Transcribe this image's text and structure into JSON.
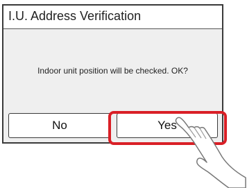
{
  "dialog": {
    "title": "I.U. Address Verification",
    "message": "Indoor unit position will be checked. OK?",
    "buttons": {
      "no_label": "No",
      "yes_label": "Yes"
    }
  },
  "colors": {
    "highlight": "#d91f26",
    "panel": "#efefef",
    "border": "#3a3a3a"
  },
  "icons": {
    "pointer": "hand-pointer-icon"
  }
}
